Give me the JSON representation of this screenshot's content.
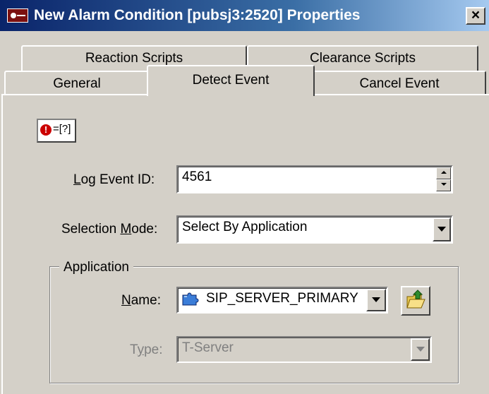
{
  "window": {
    "title": "New Alarm Condition [pubsj3:2520] Properties",
    "close_label": "×"
  },
  "tabs": {
    "row1": [
      {
        "label": "Reaction Scripts"
      },
      {
        "label": "Clearance Scripts"
      }
    ],
    "row2": [
      {
        "label": "General"
      },
      {
        "label": "Detect Event",
        "selected": true
      },
      {
        "label": "Cancel Event"
      }
    ]
  },
  "event_icon": {
    "bang": "!",
    "expr": "=[?]"
  },
  "log_event": {
    "label_pre": "",
    "label_ul": "L",
    "label_post": "og Event ID:",
    "value": "4561"
  },
  "selection_mode": {
    "label_pre": "Selection ",
    "label_ul": "M",
    "label_post": "ode:",
    "value": "Select By Application"
  },
  "application": {
    "group_title": "Application",
    "name": {
      "label_pre": "",
      "label_ul": "N",
      "label_post": "ame:",
      "value": "SIP_SERVER_PRIMARY"
    },
    "type": {
      "label_pre": "T",
      "label_ul": "y",
      "label_post": "pe:",
      "value": "T-Server"
    }
  },
  "icons": {
    "window": "alarm-window-icon",
    "event": "log-event-icon",
    "app": "puzzle-piece-icon",
    "browse": "folder-open-icon"
  },
  "colors": {
    "titlebar_start": "#0a246a",
    "titlebar_end": "#a6caf0",
    "face": "#d4d0c8",
    "alarm_red": "#cc0000",
    "app_icon_blue": "#3b7dd8"
  }
}
